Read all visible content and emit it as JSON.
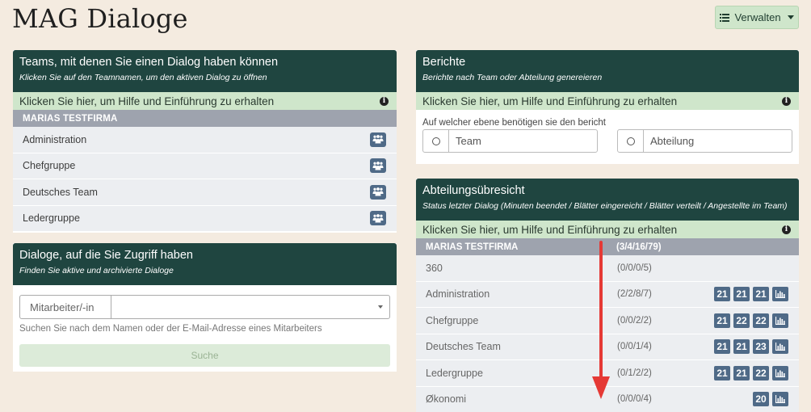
{
  "page": {
    "title": "MAG Dialoge"
  },
  "header": {
    "manage_label": "Verwalten"
  },
  "teams_panel": {
    "title": "Teams, mit denen Sie einen Dialog haben können",
    "subtitle": "Klicken Sie auf den Teamnamen, um den aktiven Dialog zu öffnen",
    "help": "Klicken Sie hier, um Hilfe und Einführung zu erhalten",
    "company": "MARIAS TESTFIRMA",
    "teams": [
      "Administration",
      "Chefgruppe",
      "Deutsches Team",
      "Ledergruppe"
    ]
  },
  "search_panel": {
    "title": "Dialoge, auf die Sie Zugriff haben",
    "subtitle": "Finden Sie aktive und archivierte Dialoge",
    "field_label": "Mitarbeiter/-in",
    "hint": "Suchen Sie nach dem Namen oder der E-Mail-Adresse eines Mitarbeiters",
    "button": "Suche"
  },
  "reports_panel": {
    "title": "Berichte",
    "subtitle": "Berichte nach Team oder Abteilung genereieren",
    "help": "Klicken Sie hier, um Hilfe und Einführung zu erhalten",
    "question": "Auf welcher ebene benötigen sie den bericht",
    "options": [
      "Team",
      "Abteilung"
    ]
  },
  "dept_panel": {
    "title": "Abteilungsübresicht",
    "subtitle": "Status letzter Dialog (Minuten beendet / Blätter eingereicht / Blätter verteilt / Angestellte im Team)",
    "help": "Klicken Sie hier, um Hilfe und Einführung zu erhalten",
    "company": "MARIAS TESTFIRMA",
    "company_stats": "(3/4/16/79)",
    "rows": [
      {
        "name": "360",
        "stats": "(0/0/0/5)",
        "badges": []
      },
      {
        "name": "Administration",
        "stats": "(2/2/8/7)",
        "badges": [
          "21",
          "21",
          "21"
        ]
      },
      {
        "name": "Chefgruppe",
        "stats": "(0/0/2/2)",
        "badges": [
          "21",
          "22",
          "22"
        ]
      },
      {
        "name": "Deutsches Team",
        "stats": "(0/0/1/4)",
        "badges": [
          "21",
          "21",
          "23"
        ]
      },
      {
        "name": "Ledergruppe",
        "stats": "(0/1/2/2)",
        "badges": [
          "21",
          "21",
          "22"
        ]
      },
      {
        "name": "Økonomi",
        "stats": "(0/0/0/4)",
        "badges": [
          "20"
        ]
      }
    ]
  },
  "colors": {
    "header_bg": "#1f4540",
    "help_bg": "#cfe6cb",
    "company_bg": "#9ea3ae",
    "badge_bg": "#4f6a87",
    "arrow": "#e53935"
  },
  "icons": {
    "manage": "list-icon",
    "team_button": "group-icon",
    "info": "info-icon",
    "chart": "bar-chart-icon"
  }
}
